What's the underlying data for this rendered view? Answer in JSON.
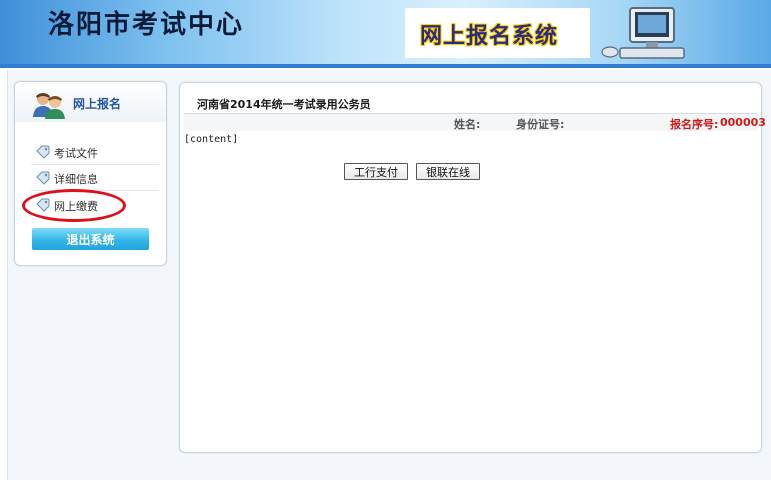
{
  "header": {
    "site_title": "洛阳市考试中心",
    "system_name": "网上报名系统"
  },
  "sidebar": {
    "title": "网上报名",
    "items": [
      {
        "label": "考试文件",
        "icon": "tag-icon"
      },
      {
        "label": "详细信息",
        "icon": "tag-icon"
      },
      {
        "label": "网上缴费",
        "icon": "tag-icon",
        "highlighted": true
      }
    ],
    "logout_label": "退出系统"
  },
  "main": {
    "exam_title": "河南省2014年统一考试录用公务员",
    "name_label": "姓名:",
    "id_label": "身份证号:",
    "regno_label": "报名序号:",
    "regno_value": "000003",
    "content_placeholder": "[content]",
    "buttons": {
      "icbc": "工行支付",
      "unionpay": "银联在线"
    }
  },
  "colors": {
    "header_blue": "#3f8fd8",
    "accent_blue": "#2257a5",
    "highlight_red": "#e0101b",
    "regno_red": "#d11a1a",
    "logout_button": "#35b6e8"
  }
}
